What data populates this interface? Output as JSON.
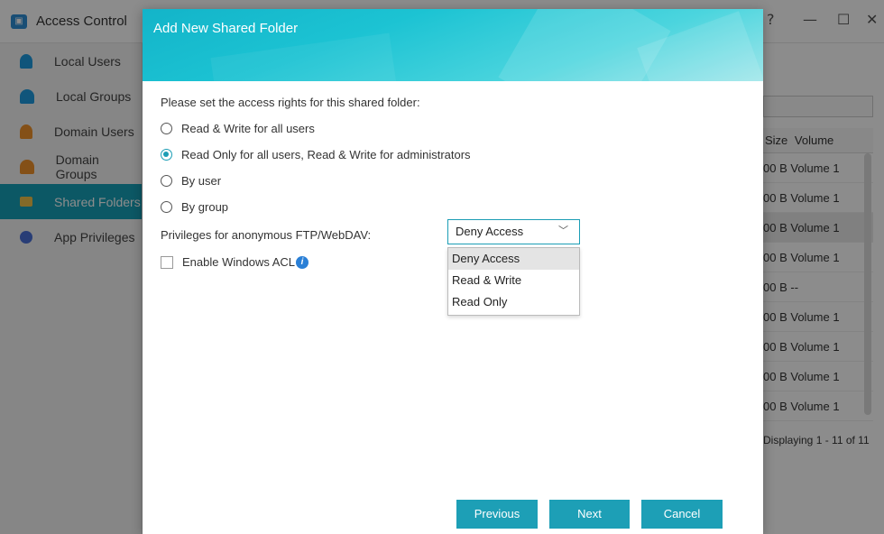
{
  "app": {
    "title": "Access Control",
    "icon": "access-control-icon",
    "window_controls": {
      "help": "?",
      "minimize": "—",
      "maximize": "☐",
      "close": "✕"
    }
  },
  "sidebar": {
    "items": [
      {
        "label": "Local Users",
        "icon": "user-icon",
        "active": false
      },
      {
        "label": "Local Groups",
        "icon": "group-icon",
        "active": false
      },
      {
        "label": "Domain Users",
        "icon": "domain-user-icon",
        "active": false
      },
      {
        "label": "Domain Groups",
        "icon": "domain-group-icon",
        "active": false
      },
      {
        "label": "Shared Folders",
        "icon": "folder-icon",
        "active": true
      },
      {
        "label": "App Privileges",
        "icon": "app-privileges-icon",
        "active": false
      }
    ]
  },
  "background_table": {
    "headers": {
      "size": "Size",
      "volume": "Volume"
    },
    "rows": [
      {
        "size": "00 B",
        "volume": "Volume 1"
      },
      {
        "size": "00 B",
        "volume": "Volume 1"
      },
      {
        "size": "00 B",
        "volume": "Volume 1"
      },
      {
        "size": "00 B",
        "volume": "Volume 1"
      },
      {
        "size": "00 B",
        "volume": "--"
      },
      {
        "size": "00 B",
        "volume": "Volume 1"
      },
      {
        "size": "00 B",
        "volume": "Volume 1"
      },
      {
        "size": "00 B",
        "volume": "Volume 1"
      },
      {
        "size": "00 B",
        "volume": "Volume 1"
      }
    ],
    "footer": "Displaying 1 - 11 of 11"
  },
  "dialog": {
    "title": "Add New Shared Folder",
    "prompt": "Please set the access rights for this shared folder:",
    "options": [
      {
        "label": "Read & Write for all users",
        "checked": false
      },
      {
        "label": "Read Only for all users, Read & Write for administrators",
        "checked": true
      },
      {
        "label": "By user",
        "checked": false
      },
      {
        "label": "By group",
        "checked": false
      }
    ],
    "anonymous": {
      "label": "Privileges for anonymous FTP/WebDAV:",
      "selected": "Deny Access",
      "options": [
        "Deny Access",
        "Read & Write",
        "Read Only"
      ]
    },
    "acl": {
      "label": "Enable Windows ACL",
      "checked": false
    },
    "buttons": {
      "previous": "Previous",
      "next": "Next",
      "cancel": "Cancel"
    }
  },
  "colors": {
    "accent": "#1d9fb6",
    "header_gradient_start": "#13b4c9",
    "header_gradient_end": "#9fe6ea",
    "sidebar_active": "#16a0b8"
  }
}
